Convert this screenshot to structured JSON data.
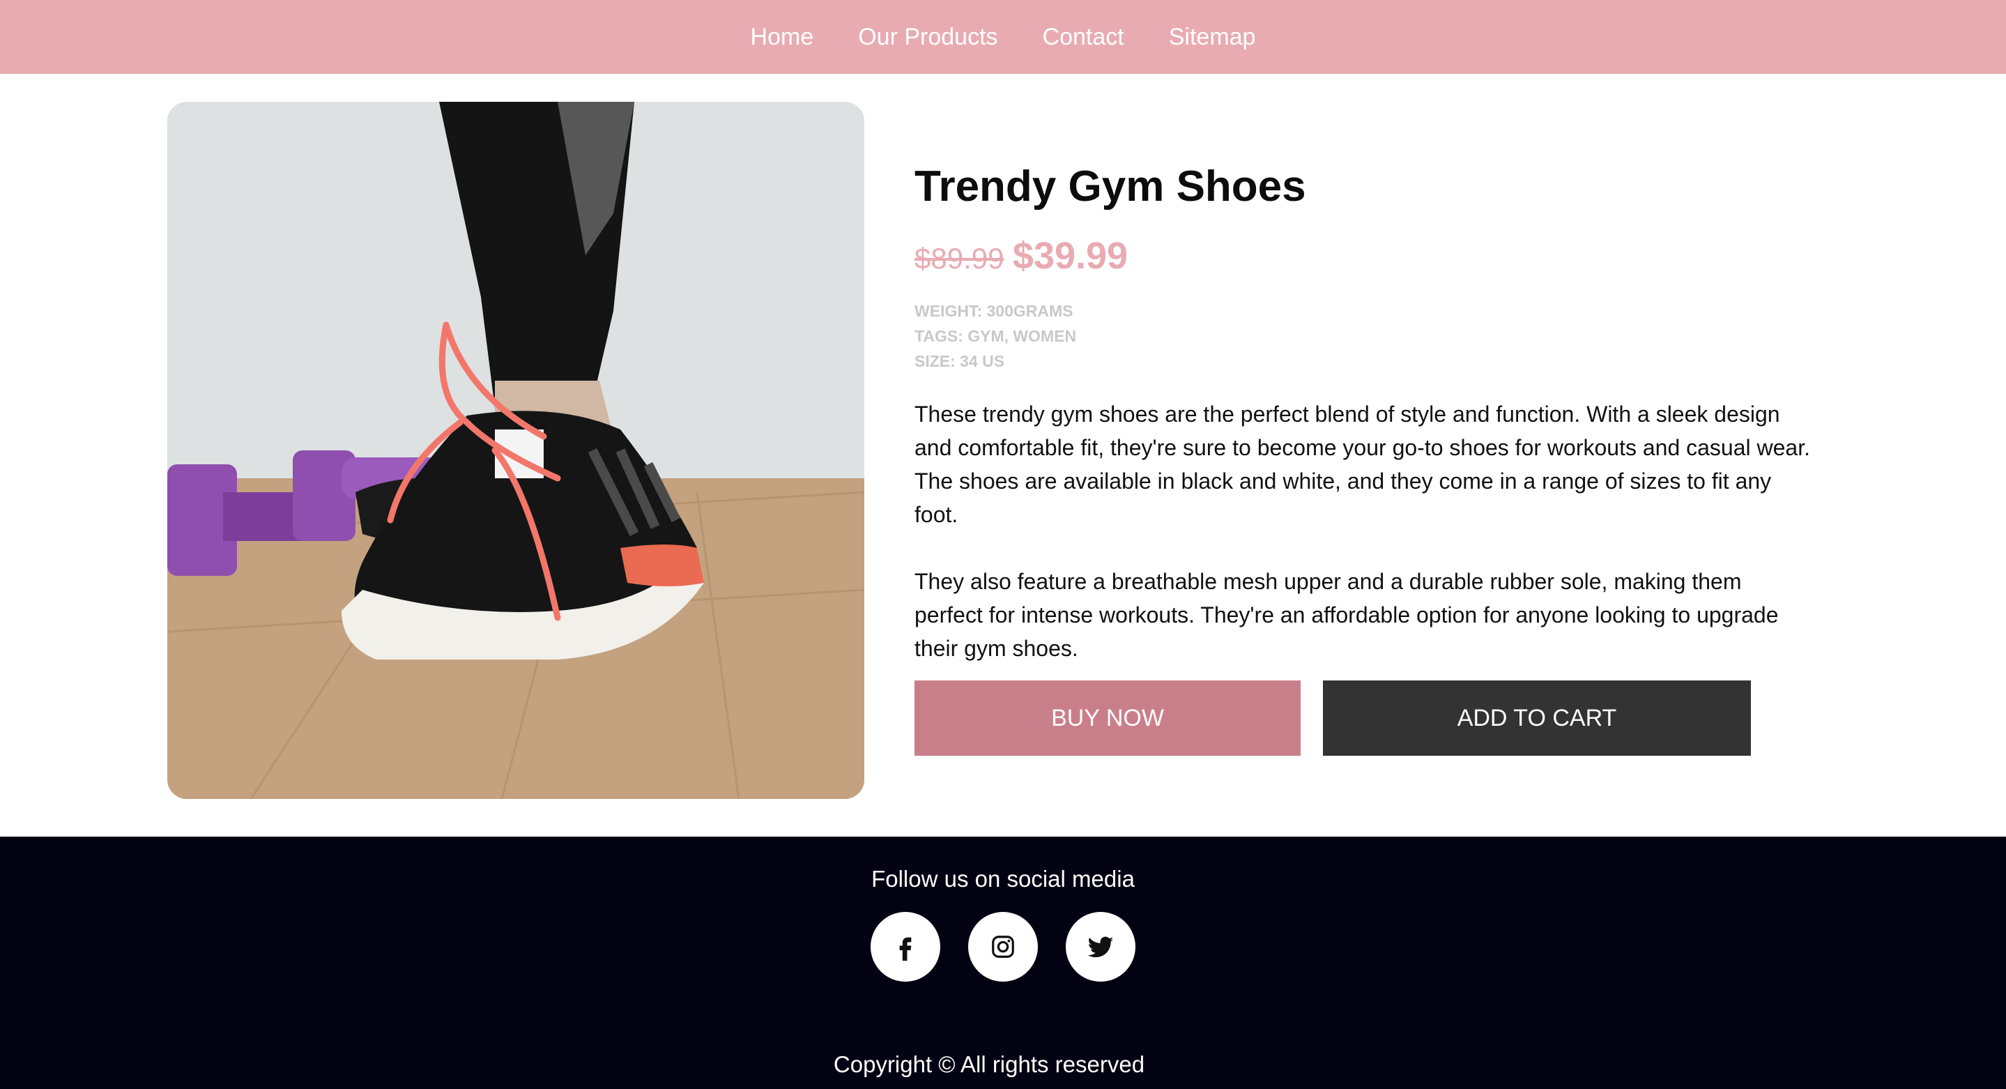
{
  "nav": {
    "items": [
      "Home",
      "Our Products",
      "Contact",
      "Sitemap"
    ]
  },
  "product": {
    "title": "Trendy Gym Shoes",
    "old_price": "$89.99",
    "price": "$39.99",
    "meta": {
      "weight": "WEIGHT: 300GRAMS",
      "tags": "TAGS: GYM, WOMEN",
      "size": "SIZE: 34 US"
    },
    "description": [
      "These trendy gym shoes are the perfect blend of style and function. With a sleek design and comfortable fit, they're sure to become your go-to shoes for workouts and casual wear. The shoes are available in black and white, and they come in a range of sizes to fit any foot.",
      "They also feature a breathable mesh upper and a durable rubber sole, making them perfect for intense workouts. They're an affordable option for anyone looking to upgrade their gym shoes."
    ],
    "buy_label": "BUY NOW",
    "cart_label": "ADD TO CART"
  },
  "footer": {
    "follow": "Follow us on social media",
    "socials": [
      "facebook-icon",
      "instagram-icon",
      "twitter-icon"
    ],
    "copyright": "Copyright © All rights reserved"
  },
  "colors": {
    "nav_bg": "#e8abb2",
    "price": "#e8abb2",
    "buy_button": "#c97f8a",
    "cart_button": "#333333",
    "footer_bg": "#030212"
  }
}
